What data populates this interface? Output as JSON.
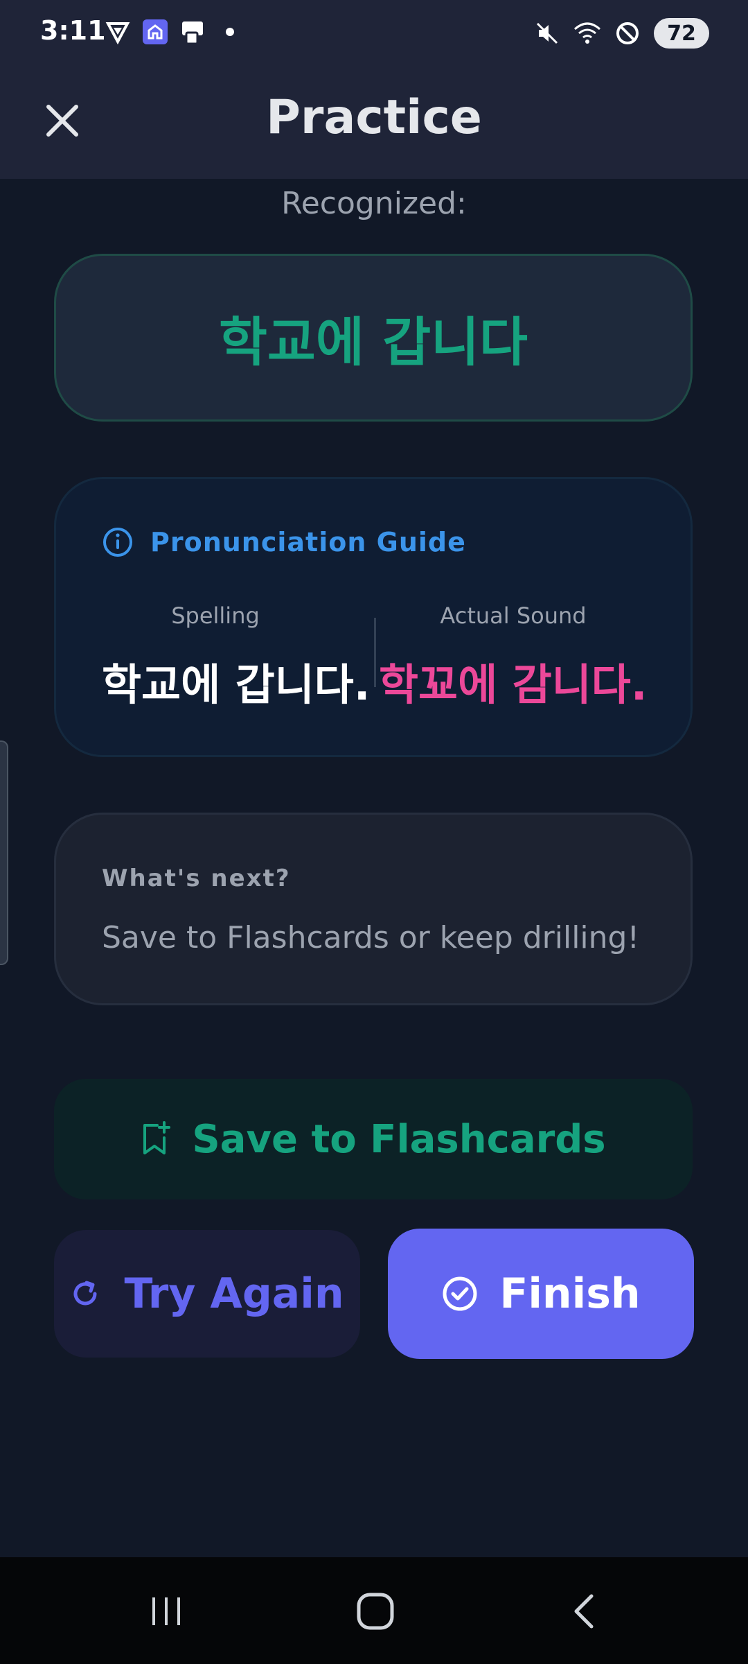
{
  "status_bar": {
    "time": "3:11",
    "battery": "72",
    "left_icons": [
      "vpn-shield-icon",
      "home-app-icon",
      "device-app-icon",
      "notification-dot-icon"
    ],
    "right_icons": [
      "mute-icon",
      "wifi-icon",
      "do-not-disturb-icon",
      "battery-icon"
    ]
  },
  "header": {
    "title": "Practice",
    "close_icon": "close-icon"
  },
  "recognized": {
    "label": "Recognized:",
    "text": "학교에 갑니다"
  },
  "pronunciation_guide": {
    "title": "Pronunciation Guide",
    "icon": "info-icon",
    "spelling_label": "Spelling",
    "sound_label": "Actual Sound",
    "spelling_text": "학교에 갑니다.",
    "sound_text": "학꾜에 감니다."
  },
  "whats_next": {
    "label": "What's next?",
    "text": "Save to Flashcards or keep drilling!"
  },
  "actions": {
    "save_label": "Save to Flashcards",
    "save_icon": "bookmark-add-icon",
    "try_again_label": "Try Again",
    "try_again_icon": "refresh-icon",
    "finish_label": "Finish",
    "finish_icon": "check-circle-icon"
  },
  "colors": {
    "background": "#111827",
    "header": "#1f2438",
    "green_accent": "#16a37f",
    "blue_accent": "#3b94ea",
    "pink_accent": "#ec4899",
    "primary": "#6366f1"
  },
  "nav_bar": {
    "icons": [
      "recent-apps-icon",
      "home-icon",
      "back-icon"
    ]
  }
}
